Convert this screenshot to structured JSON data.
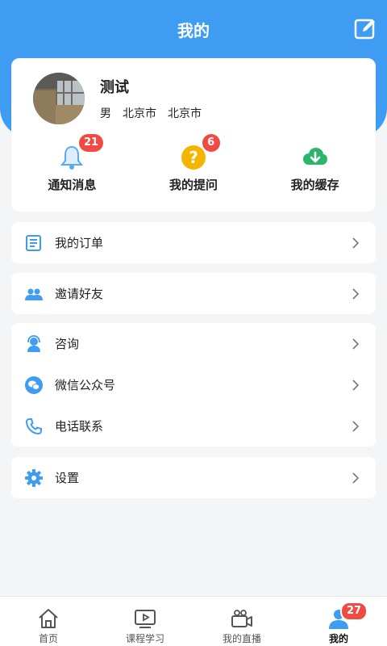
{
  "header": {
    "title": "我的"
  },
  "profile": {
    "name": "测试",
    "gender": "男",
    "province": "北京市",
    "city": "北京市"
  },
  "quick": [
    {
      "label": "通知消息",
      "badge": "21",
      "icon": "bell-icon"
    },
    {
      "label": "我的提问",
      "badge": "6",
      "icon": "question-icon"
    },
    {
      "label": "我的缓存",
      "badge": "",
      "icon": "cloud-download-icon"
    }
  ],
  "menu": {
    "orders": "我的订单",
    "invite": "邀请好友",
    "consult": "咨询",
    "wechat": "微信公众号",
    "phone": "电话联系",
    "settings": "设置"
  },
  "tabbar": {
    "home": "首页",
    "courses": "课程学习",
    "live": "我的直播",
    "mine": "我的",
    "mine_badge": "27"
  },
  "colors": {
    "primary": "#3f9cf3",
    "badge": "#f04a43",
    "bell": "#5aa9ee",
    "question": "#f4b400",
    "download": "#2db56b"
  }
}
